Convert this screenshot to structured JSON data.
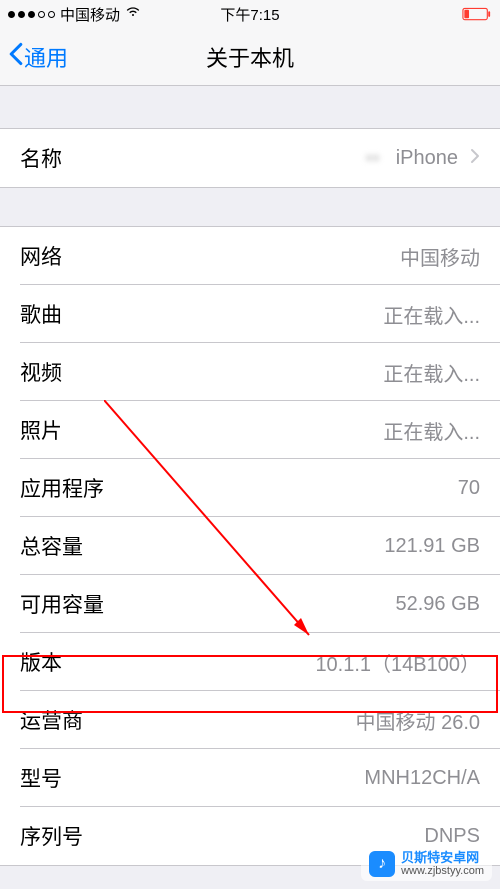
{
  "status": {
    "carrier": "中国移动",
    "time": "下午7:15"
  },
  "nav": {
    "back_label": "通用",
    "title": "关于本机"
  },
  "name_row": {
    "label": "名称",
    "value": "iPhone"
  },
  "rows": [
    {
      "label": "网络",
      "value": "中国移动"
    },
    {
      "label": "歌曲",
      "value": "正在载入..."
    },
    {
      "label": "视频",
      "value": "正在载入..."
    },
    {
      "label": "照片",
      "value": "正在载入..."
    },
    {
      "label": "应用程序",
      "value": "70"
    },
    {
      "label": "总容量",
      "value": "121.91 GB"
    },
    {
      "label": "可用容量",
      "value": "52.96 GB"
    },
    {
      "label": "版本",
      "value": "10.1.1（14B100）"
    },
    {
      "label": "运营商",
      "value": "中国移动 26.0"
    },
    {
      "label": "型号",
      "value": "MNH12CH/A"
    },
    {
      "label": "序列号",
      "value": "DNPS"
    }
  ],
  "watermark": {
    "title": "贝斯特安卓网",
    "url": "www.zjbstyy.com"
  }
}
